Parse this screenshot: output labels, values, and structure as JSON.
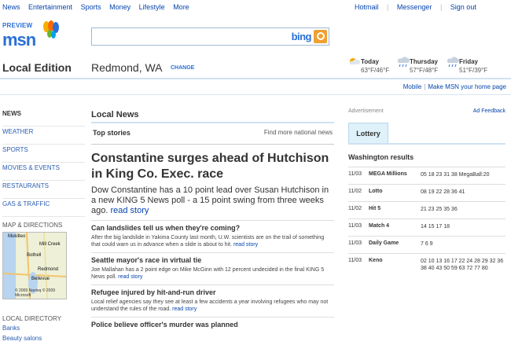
{
  "topnav": {
    "left": [
      "News",
      "Entertainment",
      "Sports",
      "Money",
      "Lifestyle",
      "More"
    ],
    "right": [
      "Hotmail",
      "Messenger",
      "Sign out"
    ]
  },
  "brand": {
    "preview": "PREVIEW",
    "name": "msn"
  },
  "search": {
    "placeholder": "",
    "engine": "bing"
  },
  "location": {
    "edition": "Local Edition",
    "city": "Redmond, WA",
    "change": "CHANGE"
  },
  "weather": [
    {
      "day": "Today",
      "temps": "63°F/46°F",
      "icon": "sun-icon"
    },
    {
      "day": "Thursday",
      "temps": "57°F/48°F",
      "icon": "rain-cloud-icon"
    },
    {
      "day": "Friday",
      "temps": "51°F/39°F",
      "icon": "rain-cloud-icon"
    }
  ],
  "toplinks": [
    "Mobile",
    "Make MSN your home page"
  ],
  "leftnav": {
    "items": [
      "NEWS",
      "WEATHER",
      "SPORTS",
      "MOVIES & EVENTS",
      "RESTAURANTS",
      "GAS & TRAFFIC"
    ],
    "map_heading": "MAP & DIRECTIONS",
    "map_labels": [
      "Mukilteo",
      "Mill Creek",
      "Bothell",
      "Redmond",
      "Bellevue"
    ],
    "map_copyright": "© 2009 Navteq\n© 2009 Microsoft",
    "directory_heading": "LOCAL DIRECTORY",
    "directory_links": [
      "Banks",
      "Beauty salons"
    ]
  },
  "main": {
    "heading": "Local News",
    "top_stories": "Top stories",
    "more_national": "Find more national news",
    "lead_title": "Constantine surges ahead of Hutchison in King Co. Exec. race",
    "lead_text": "Dow Constantine has a 10 point lead over Susan Hutchison in a new KING 5 News poll - a 15 point swing from three weeks ago.",
    "read_story": "read story",
    "stories": [
      {
        "title": "Can landslides tell us when they're coming?",
        "summary": "After the big landslide in Yakima County last month, U.W. scientists are on the trail of something that could warn us in advance when a slide is about to hit."
      },
      {
        "title": "Seattle mayor's race in virtual tie",
        "summary": "Joe Mallahan has a 2 point edge on Mike McGinn with 12 percent undecided in the final KING 5 News poll."
      },
      {
        "title": "Refugee injured by hit-and-run driver",
        "summary": "Local relief agencies say they see at least a few accidents a year involving refugees who may not understand the rules of the road."
      },
      {
        "title": "Police believe officer's murder was planned",
        "summary": ""
      }
    ]
  },
  "right": {
    "ad_label": "Advertisement",
    "ad_feedback": "Ad Feedback",
    "tab": "Lottery",
    "results_title": "Washington results",
    "results": [
      {
        "date": "11/03",
        "game": "MEGA Millions",
        "numbers": "05 18 23 31 38 MegaBall:20"
      },
      {
        "date": "11/02",
        "game": "Lotto",
        "numbers": "08 19 22 28 36 41"
      },
      {
        "date": "11/02",
        "game": "Hit 5",
        "numbers": "21 23 25 35 36"
      },
      {
        "date": "11/03",
        "game": "Match 4",
        "numbers": "14 15 17 18"
      },
      {
        "date": "11/03",
        "game": "Daily Game",
        "numbers": "7 6 9"
      },
      {
        "date": "11/03",
        "game": "Keno",
        "numbers": "02 10 13 16 17 22 24 28 29 32 36 38 40 43 50 59 63 72 77 80"
      }
    ]
  }
}
